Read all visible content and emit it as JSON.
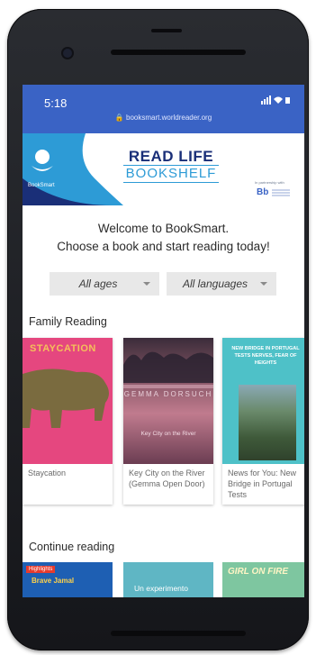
{
  "status_bar": {
    "time": "5:18",
    "url": "booksmart.worldreader.org",
    "icons": "signal-wifi-battery"
  },
  "banner": {
    "logo_label": "BookSmart",
    "read_life": "READ LIFE",
    "bookshelf": "BOOKSHELF",
    "partner_text": "In partnership with",
    "partner_logo": "Bb"
  },
  "welcome": {
    "line1": "Welcome to BookSmart.",
    "line2": "Choose a book and start reading today!"
  },
  "filters": {
    "ages": "All ages",
    "languages": "All languages"
  },
  "family_reading": {
    "title": "Family Reading",
    "books": [
      {
        "cover_text": "STAYCATION",
        "title": "Staycation"
      },
      {
        "cover_author": "GEMMA DORSUCH",
        "cover_title": "Key City on the River",
        "title": "Key City on the River (Gemma Open Door)"
      },
      {
        "cover_text": "NEW BRIDGE IN PORTUGAL TESTS NERVES, FEAR OF HEIGHTS",
        "title": "News for You: New Bridge in Portugal Tests"
      }
    ]
  },
  "continue_reading": {
    "title": "Continue reading",
    "books": [
      {
        "cover_badge": "Highlights",
        "cover_text": "Brave Jamal"
      },
      {
        "cover_text": "Un experimento"
      },
      {
        "cover_text": "GIRL ON FIRE"
      }
    ]
  },
  "colors": {
    "status_bar": "#3a63c5",
    "brand_navy": "#1a2f78",
    "brand_blue": "#2d9bd6"
  }
}
